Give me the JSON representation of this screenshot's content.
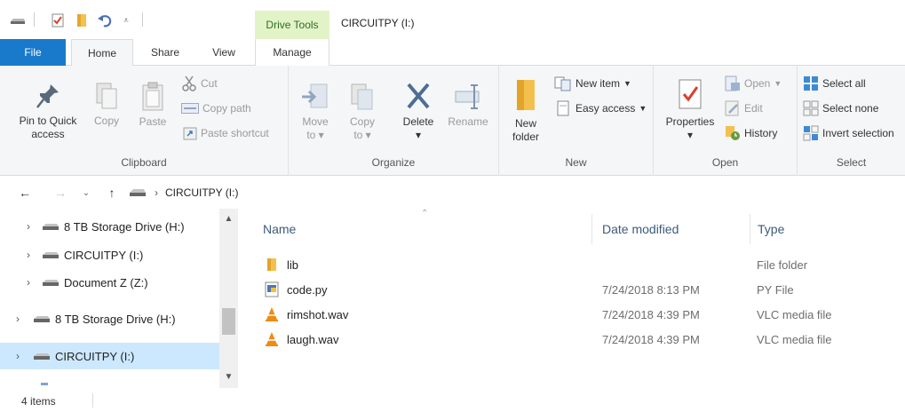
{
  "window": {
    "title": "CIRCUITPY (I:)",
    "contextual_tab": "Drive Tools"
  },
  "tabs": {
    "file": "File",
    "home": "Home",
    "share": "Share",
    "view": "View",
    "manage": "Manage"
  },
  "ribbon": {
    "clipboard": {
      "label": "Clipboard",
      "pin_line1": "Pin to Quick",
      "pin_line2": "access",
      "copy": "Copy",
      "paste": "Paste",
      "cut": "Cut",
      "copy_path": "Copy path",
      "paste_shortcut": "Paste shortcut"
    },
    "organize": {
      "label": "Organize",
      "move_line1": "Move",
      "move_line2": "to",
      "copy_line1": "Copy",
      "copy_line2": "to",
      "delete": "Delete",
      "rename": "Rename"
    },
    "new": {
      "label": "New",
      "folder_line1": "New",
      "folder_line2": "folder",
      "new_item": "New item",
      "easy_access": "Easy access"
    },
    "open": {
      "label": "Open",
      "properties": "Properties",
      "open": "Open",
      "edit": "Edit",
      "history": "History"
    },
    "select": {
      "label": "Select",
      "select_all": "Select all",
      "select_none": "Select none",
      "invert": "Invert selection"
    }
  },
  "address": {
    "path": "CIRCUITPY (I:)"
  },
  "nav": {
    "items": [
      {
        "label": "8 TB Storage Drive (H:)"
      },
      {
        "label": "CIRCUITPY (I:)"
      },
      {
        "label": "Document Z (Z:)"
      },
      {
        "label": "8 TB Storage Drive (H:)"
      },
      {
        "label": "CIRCUITPY (I:)"
      }
    ],
    "scroll_position": 0.7
  },
  "columns": {
    "name": "Name",
    "date": "Date modified",
    "type": "Type"
  },
  "files": [
    {
      "name": "lib",
      "date": "",
      "type": "File folder",
      "icon": "folder-icon"
    },
    {
      "name": "code.py",
      "date": "7/24/2018 8:13 PM",
      "type": "PY File",
      "icon": "python-file-icon"
    },
    {
      "name": "rimshot.wav",
      "date": "7/24/2018 4:39 PM",
      "type": "VLC media file",
      "icon": "vlc-icon"
    },
    {
      "name": "laugh.wav",
      "date": "7/24/2018 4:39 PM",
      "type": "VLC media file",
      "icon": "vlc-icon"
    }
  ],
  "status": {
    "count": "4 items"
  },
  "colors": {
    "file_tab": "#1979ca",
    "drive_tools": "#e2f4c7",
    "selection": "#cce8ff",
    "header_text": "#3c5b7a"
  }
}
